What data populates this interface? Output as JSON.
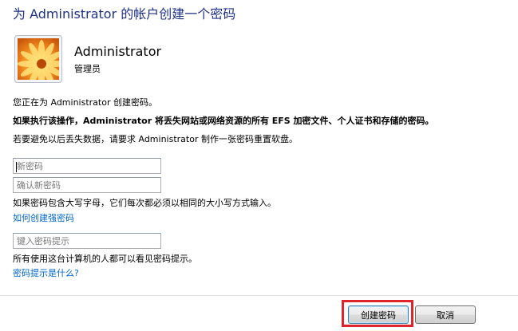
{
  "page_title": "为 Administrator 的帐户创建一个密码",
  "user": {
    "name": "Administrator",
    "role": "管理员",
    "avatar_icon": "flower-avatar-icon"
  },
  "messages": {
    "line1": "您正在为 Administrator 创建密码。",
    "warning": "如果执行该操作，Administrator 将丢失网站或网络资源的所有 EFS 加密文件、个人证书和存储的密码。",
    "line3": "若要避免以后丢失数据，请要求 Administrator 制作一张密码重置软盘。"
  },
  "fields": {
    "new_password": {
      "placeholder": "新密码",
      "value": ""
    },
    "confirm_password": {
      "placeholder": "确认新密码",
      "value": ""
    },
    "password_hint": {
      "placeholder": "键入密码提示",
      "value": ""
    }
  },
  "case_note": "如果密码包含大写字母，它们每次都必须以相同的大小写方式输入。",
  "strong_password_link": "如何创建强密码",
  "hint_note": "所有使用这台计算机的人都可以看见密码提示。",
  "hint_link": "密码提示是什么?",
  "buttons": {
    "create": "创建密码",
    "cancel": "取消"
  },
  "colors": {
    "title": "#1e3287",
    "link": "#0066cc",
    "highlight": "#e0242b"
  }
}
